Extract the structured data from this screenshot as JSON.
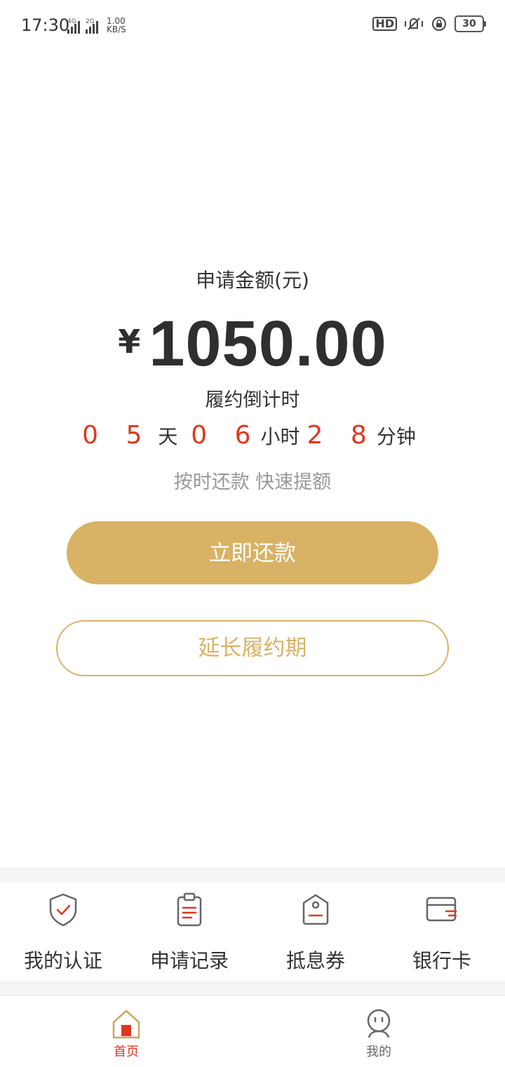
{
  "status_bar": {
    "time": "17:30",
    "net1": "4G",
    "net2": "2G",
    "speed_value": "1.00",
    "speed_unit": "KB/S",
    "hd": "HD",
    "battery": "30"
  },
  "main": {
    "amount_title": "申请金额(元)",
    "currency": "¥",
    "amount": "1050.00",
    "countdown_label": "履约倒计时",
    "countdown": {
      "days": "0 5",
      "days_unit": "天",
      "hours": "0 6",
      "hours_unit": "小时",
      "minutes": "2 8",
      "minutes_unit": "分钟"
    },
    "tagline": "按时还款 快速提额",
    "primary_button": "立即还款",
    "secondary_button": "延长履约期"
  },
  "quick_actions": [
    {
      "label": "我的认证",
      "icon": "shield-check-icon"
    },
    {
      "label": "申请记录",
      "icon": "clipboard-icon"
    },
    {
      "label": "抵息券",
      "icon": "coupon-tag-icon"
    },
    {
      "label": "银行卡",
      "icon": "bank-card-icon"
    }
  ],
  "tab_bar": [
    {
      "label": "首页",
      "icon": "home-icon",
      "active": true
    },
    {
      "label": "我的",
      "icon": "profile-face-icon",
      "active": false
    }
  ],
  "colors": {
    "accent_gold": "#d8b265",
    "countdown_red": "#e0371f",
    "text_dark": "#333333",
    "text_muted": "#999999"
  }
}
